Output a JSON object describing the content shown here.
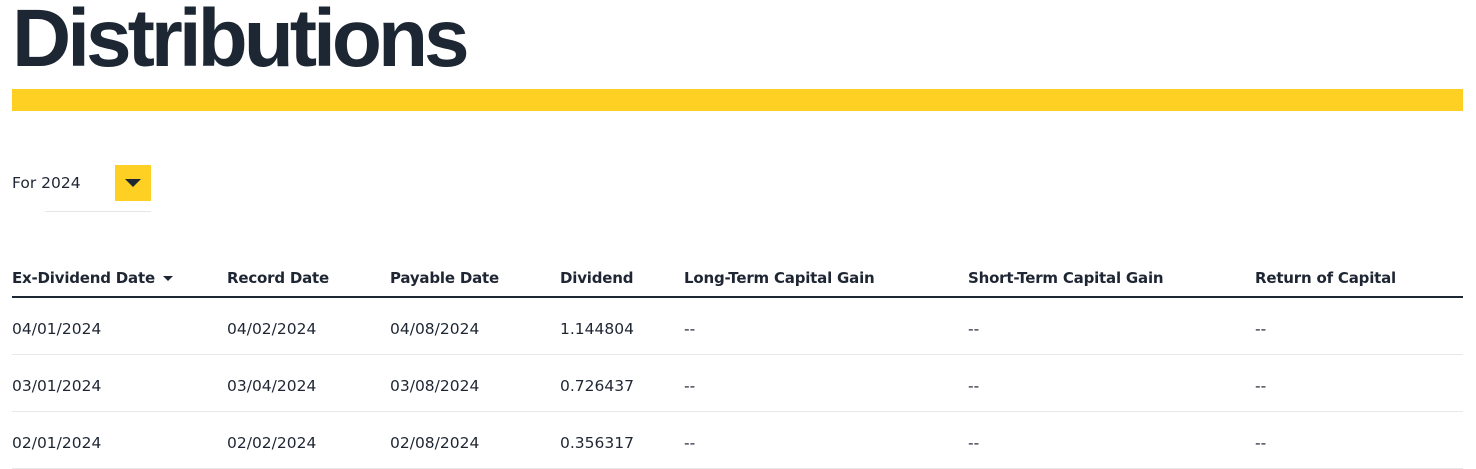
{
  "page": {
    "title": "Distributions"
  },
  "colors": {
    "accent": "#fdd023",
    "text": "#1f2633",
    "rule": "#1d2633"
  },
  "filter": {
    "label": "For 2024",
    "dropdown_icon": "chevron-down-icon"
  },
  "table": {
    "columns": [
      {
        "label": "Ex-Dividend Date",
        "sortable": true
      },
      {
        "label": "Record Date"
      },
      {
        "label": "Payable Date"
      },
      {
        "label": "Dividend"
      },
      {
        "label": "Long-Term Capital Gain"
      },
      {
        "label": "Short-Term Capital Gain"
      },
      {
        "label": "Return of Capital"
      }
    ],
    "rows": [
      [
        "04/01/2024",
        "04/02/2024",
        "04/08/2024",
        "1.144804",
        "--",
        "--",
        "--"
      ],
      [
        "03/01/2024",
        "03/04/2024",
        "03/08/2024",
        "0.726437",
        "--",
        "--",
        "--"
      ],
      [
        "02/01/2024",
        "02/02/2024",
        "02/08/2024",
        "0.356317",
        "--",
        "--",
        "--"
      ]
    ]
  }
}
